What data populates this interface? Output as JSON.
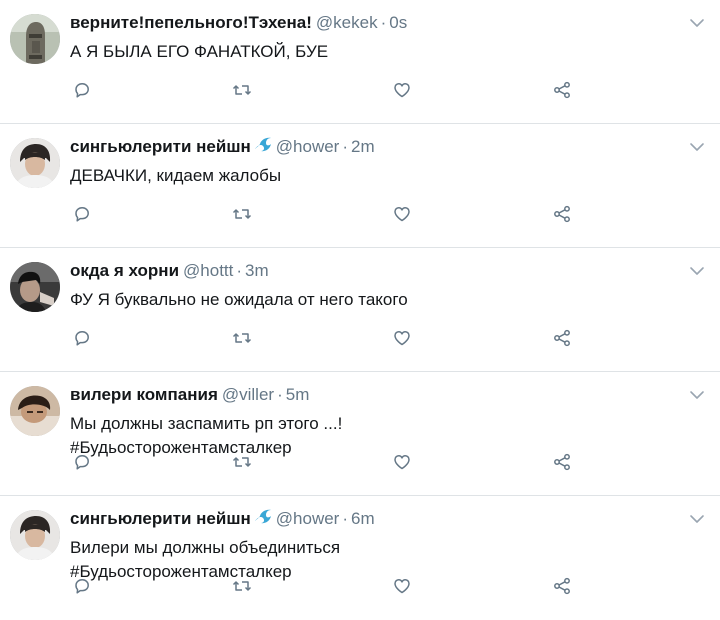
{
  "tweets": [
    {
      "name": "верните!пепельного!Тэхена!",
      "handle": "@kekek",
      "time": "0s",
      "verified": false,
      "lines": [
        "А Я БЫЛА ЕГО ФАНАТКОЙ, БУЕ"
      ],
      "avatar": "statue-avatar"
    },
    {
      "name": "сингьюлерити нейшн",
      "handle": "@hower",
      "time": "2m",
      "verified": true,
      "lines": [
        "ДЕВАЧКИ, кидаем жалобы"
      ],
      "avatar": "person-avatar"
    },
    {
      "name": "окда я хорни",
      "handle": "@hottt",
      "time": "3m",
      "verified": false,
      "lines": [
        "ФУ Я буквально не ожидала от него такого"
      ],
      "avatar": "person-dark-avatar"
    },
    {
      "name": "вилери компания",
      "handle": "@viller",
      "time": "5m",
      "verified": false,
      "lines": [
        "Мы должны заспамить рп этого ...!",
        "#Будьосторожентамсталкер"
      ],
      "avatar": "person-lying-avatar"
    },
    {
      "name": "сингьюлерити нейшн",
      "handle": "@hower",
      "time": "6m",
      "verified": true,
      "lines": [
        "Вилери мы должны объединиться",
        "#Будьосторожентамсталкер"
      ],
      "avatar": "person-avatar"
    }
  ],
  "icons": {
    "reply": "reply-icon",
    "retweet": "retweet-icon",
    "like": "heart-icon",
    "share": "share-icon",
    "menu": "chevron-down-icon",
    "verified": "wave-badge-icon"
  },
  "colors": {
    "icon": "#657786",
    "badge": "#3aa7d6",
    "divider": "#dfe3e6"
  }
}
